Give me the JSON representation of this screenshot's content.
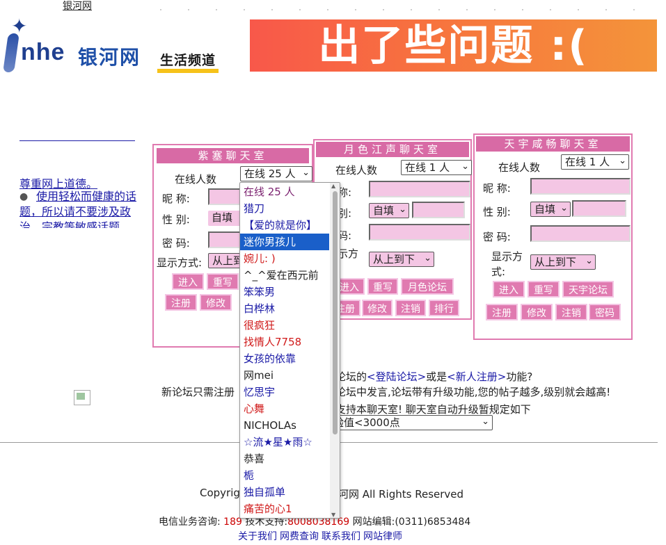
{
  "top_link": "银河网",
  "logo": {
    "brand_en": "nhe",
    "brand_cn": "银河网",
    "channel": "生活频道"
  },
  "banner": {
    "text": "出了些问题 :("
  },
  "notice": {
    "title": "尊重网上道德。",
    "body": "使用轻松而健康的话题，所以请不要涉及政治、宗教等敏感话题"
  },
  "rooms": [
    {
      "title": "紫塞聊天室",
      "online_label": "在线人数",
      "online_value": "在线 25 人",
      "nickname_label": "昵 称:",
      "gender_label": "性 别:",
      "gender_value": "自填",
      "password_label": "密 码:",
      "display_label": "显示方式:",
      "display_value": "从上到下",
      "buttons_row1": [
        "进入",
        "重写"
      ],
      "buttons_row2": [
        "注册",
        "修改"
      ]
    },
    {
      "title": "月色江声聊天室",
      "online_label": "在线人数",
      "online_value": "在线 1 人",
      "nickname_label": "昵称:",
      "gender_label": "性别:",
      "gender_value": "自填",
      "password_label": "密码:",
      "display_label": "显示方式:",
      "display_value": "从上到下",
      "buttons_row1": [
        "进入",
        "重写",
        "月色论坛"
      ],
      "buttons_row2": [
        "注册",
        "修改",
        "注销",
        "排行"
      ]
    },
    {
      "title": "天宇咸畅聊天室",
      "online_label": "在线人数",
      "online_value": "在线 1 人",
      "nickname_label": "昵 称:",
      "gender_label": "性 别:",
      "gender_value": "自填",
      "password_label": "密 码:",
      "display_label": "显示方式:",
      "display_value": "从上到下",
      "buttons_row1": [
        "进入",
        "重写",
        "天宇论坛"
      ],
      "buttons_row2": [
        "注册",
        "修改",
        "注销",
        "密码"
      ]
    }
  ],
  "dropdown": {
    "items": [
      {
        "label": "在线 25 人",
        "color": "#7a1f6e"
      },
      {
        "label": "猎刀",
        "color": "#1a1aa6"
      },
      {
        "label": "【爱的就是你】",
        "color": "#1a1aa6"
      },
      {
        "label": "迷你男孩儿",
        "color": "#ffffff"
      },
      {
        "label": "婉儿: )",
        "color": "#d01a1a"
      },
      {
        "label": "^_^爱在西元前",
        "color": "#222222"
      },
      {
        "label": "笨笨男",
        "color": "#1a1aa6"
      },
      {
        "label": "白桦林",
        "color": "#1a1aa6"
      },
      {
        "label": "很疯狂",
        "color": "#d01a1a"
      },
      {
        "label": "找情人7758",
        "color": "#d01a1a"
      },
      {
        "label": "女孩的依靠",
        "color": "#1a1aa6"
      },
      {
        "label": "网mei",
        "color": "#222222"
      },
      {
        "label": "忆思宇",
        "color": "#1a1aa6"
      },
      {
        "label": "心舞",
        "color": "#d01a1a"
      },
      {
        "label": "NICHOLAs",
        "color": "#222222"
      },
      {
        "label": "☆流★星★雨☆",
        "color": "#1a1aa6"
      },
      {
        "label": "恭喜",
        "color": "#222222"
      },
      {
        "label": "栀",
        "color": "#1a1aa6"
      },
      {
        "label": "独自孤单",
        "color": "#1a1aa6"
      },
      {
        "label": "痛苦的心1",
        "color": "#d01a1a"
      }
    ],
    "selected_index": 3
  },
  "info": {
    "line1_suffix_a": "论坛的",
    "login_link": "<登陆论坛>",
    "line1_or": "或是",
    "register_link": "<新人注册>",
    "line1_end": "功能?",
    "line2_start": "新论坛只需注册",
    "line2_end": "论坛中发言,论坛带有升级功能,您的帖子越多,级别就会越高!",
    "line3_end": "支持本聊天室! 聊天室自动升级暂规定如下",
    "level_select": "验值<3000点"
  },
  "footer": {
    "copyright_start": "Copyrig",
    "copyright_end": "河网 All Rights Reserved",
    "biz_label": "电信业务咨询:",
    "biz_value": "189",
    "tech_label": "技术支持:",
    "tech_value": "8008038169",
    "editor_label": "网站编辑:",
    "editor_value": "(0311)6853484",
    "links": [
      "关于我们",
      "网费查询",
      "联系我们",
      "网站律师"
    ]
  }
}
